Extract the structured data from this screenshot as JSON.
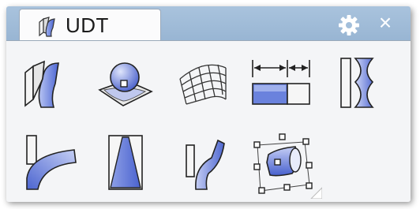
{
  "tab": {
    "label": "UDT",
    "icon": "udt-twisted-block-icon"
  },
  "window_controls": {
    "settings_icon": "gear-icon",
    "close_glyph": "×"
  },
  "tools": [
    {
      "icon": "flow-along-surface-icon"
    },
    {
      "icon": "splop-icon"
    },
    {
      "icon": "cage-edit-icon"
    },
    {
      "icon": "stretch-icon"
    },
    {
      "icon": "twist-icon"
    },
    {
      "icon": "bend-icon"
    },
    {
      "icon": "taper-icon"
    },
    {
      "icon": "flow-along-curve-icon"
    },
    {
      "icon": "maelstrom-cage-icon"
    }
  ],
  "colors": {
    "tab_bar": "#a9c3dd",
    "tab_bg": "#fbfbfc",
    "icon_blue": "#5b74d8",
    "panel_bg": "#f4f5f7"
  }
}
